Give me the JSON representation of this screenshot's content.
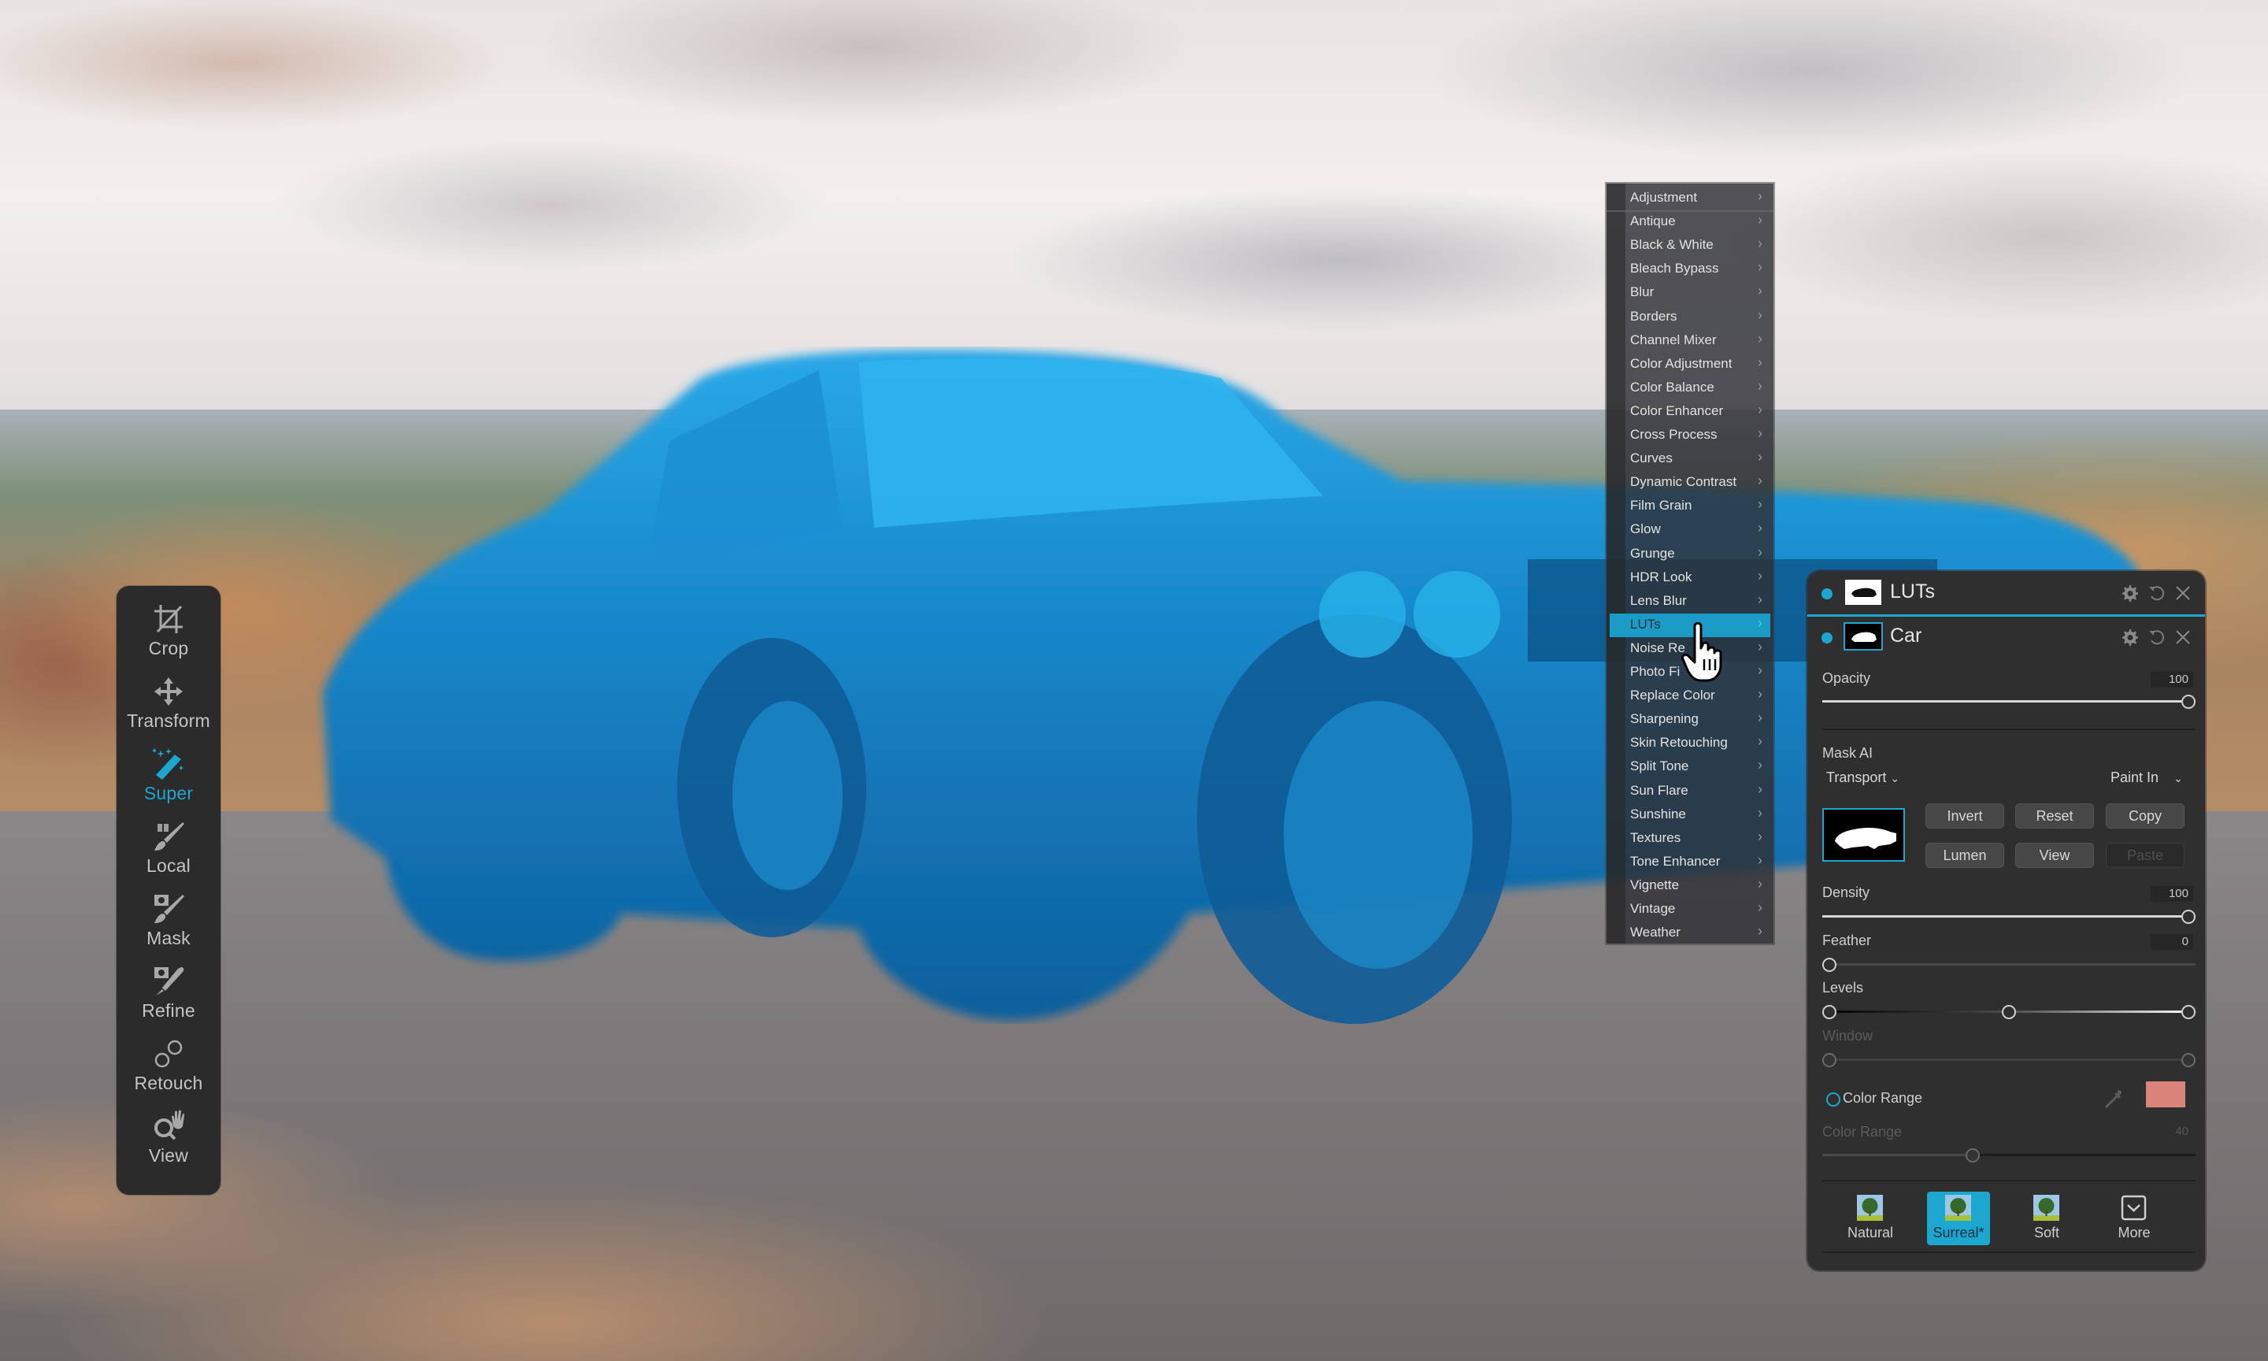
{
  "toolbar": {
    "tools": [
      {
        "id": "crop",
        "label": "Crop",
        "active": false
      },
      {
        "id": "transform",
        "label": "Transform",
        "active": false
      },
      {
        "id": "super",
        "label": "Super",
        "active": true
      },
      {
        "id": "local",
        "label": "Local",
        "active": false
      },
      {
        "id": "mask",
        "label": "Mask",
        "active": false
      },
      {
        "id": "refine",
        "label": "Refine",
        "active": false
      },
      {
        "id": "retouch",
        "label": "Retouch",
        "active": false
      },
      {
        "id": "view",
        "label": "View",
        "active": false
      }
    ]
  },
  "filter_menu": {
    "highlighted": "LUTs",
    "items": [
      "Adjustment",
      "Antique",
      "Black & White",
      "Bleach Bypass",
      "Blur",
      "Borders",
      "Channel Mixer",
      "Color Adjustment",
      "Color Balance",
      "Color Enhancer",
      "Cross Process",
      "Curves",
      "Dynamic Contrast",
      "Film Grain",
      "Glow",
      "Grunge",
      "HDR Look",
      "Lens Blur",
      "LUTs",
      "Noise Re",
      "Photo Fi",
      "Replace Color",
      "Sharpening",
      "Skin Retouching",
      "Split Tone",
      "Sun Flare",
      "Sunshine",
      "Textures",
      "Tone Enhancer",
      "Vignette",
      "Vintage",
      "Weather"
    ],
    "submenu_chevron": "›"
  },
  "panel": {
    "layers": [
      {
        "name": "LUTs",
        "active_dot": true
      },
      {
        "name": "Car",
        "active_dot": true
      }
    ],
    "opacity": {
      "label": "Opacity",
      "value": "100",
      "fraction": 1.0
    },
    "mask_ai": {
      "label": "Mask AI",
      "category": "Transport",
      "mode": "Paint In",
      "buttons": [
        {
          "label": "Invert",
          "enabled": true
        },
        {
          "label": "Reset",
          "enabled": true
        },
        {
          "label": "Copy",
          "enabled": true
        },
        {
          "label": "Lumen",
          "enabled": true
        },
        {
          "label": "View",
          "enabled": true
        },
        {
          "label": "Paste",
          "enabled": false
        }
      ]
    },
    "density": {
      "label": "Density",
      "value": "100",
      "fraction": 1.0
    },
    "feather": {
      "label": "Feather",
      "value": "0",
      "fraction": 0.0
    },
    "levels": {
      "label": "Levels",
      "low": 0.0,
      "mid": 0.5,
      "high": 1.0
    },
    "window": {
      "label": "Window",
      "low": 0.0,
      "high": 1.0,
      "enabled": false
    },
    "color_range_toggle": {
      "label": "Color Range",
      "checked": false,
      "swatch": "#d9847a"
    },
    "color_range": {
      "label": "Color Range",
      "value": "40",
      "fraction": 0.4,
      "enabled": false
    },
    "presets": [
      {
        "label": "Natural",
        "selected": false
      },
      {
        "label": "Surreal*",
        "selected": true
      },
      {
        "label": "Soft",
        "selected": false
      },
      {
        "label": "More",
        "selected": false
      }
    ]
  },
  "colors": {
    "accent": "#1ba7d0",
    "panel_bg": "#2f2f2f",
    "toolbar_bg": "#2b2b2b",
    "mask_overlay": "#1690d0"
  }
}
